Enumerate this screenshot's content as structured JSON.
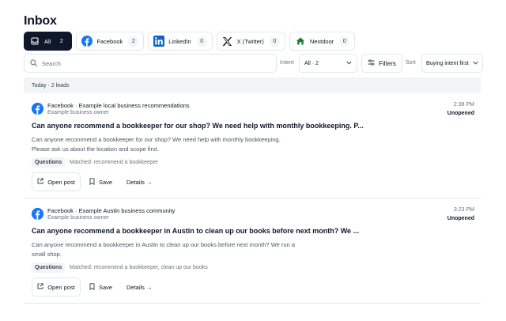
{
  "page": {
    "title": "Inbox"
  },
  "tabs": [
    {
      "label": "All",
      "count": "2",
      "icon": "inbox-icon",
      "active": true
    },
    {
      "label": "Facebook",
      "count": "2",
      "icon": "facebook-icon"
    },
    {
      "label": "LinkedIn",
      "count": "0",
      "icon": "linkedin-icon"
    },
    {
      "label": "X (Twitter)",
      "count": "0",
      "icon": "x-icon"
    },
    {
      "label": "Nextdoor",
      "count": "0",
      "icon": "nextdoor-icon"
    }
  ],
  "toolbar": {
    "search_placeholder": "Search",
    "intent_label": "Intent",
    "intent_value": "All · 2",
    "filters_label": "Filters",
    "sort_label": "Sort",
    "sort_value": "Buying intent first"
  },
  "group": {
    "label": "Today · 2 leads"
  },
  "leads": [
    {
      "source": "Facebook · Example local business recommendations",
      "author": "Example business owner",
      "time": "2:38 PM",
      "status": "Unopened",
      "title": "Can anyone recommend a bookkeeper for our shop? We need help with monthly bookkeeping. P...",
      "body_line1": "Can anyone recommend a bookkeeper for our shop? We need help with monthly bookkeeping.",
      "body_line2": "Please ask us about the location and scope first.",
      "tag": "Questions",
      "matched": "Matched: recommend a bookkeeper",
      "open_label": "Open post",
      "save_label": "Save",
      "details_label": "Details →"
    },
    {
      "source": "Facebook · Example Austin business community",
      "author": "Example business owner",
      "time": "3:23 PM",
      "status": "Unopened",
      "title": "Can anyone recommend a bookkeeper in Austin to clean up our books before next month? We ...",
      "body_line1": "Can anyone recommend a bookkeeper in Austin to clean up our books before next month? We run a",
      "body_line2": "small shop.",
      "tag": "Questions",
      "matched": "Matched: recommend a bookkeeper, clean up our books",
      "open_label": "Open post",
      "save_label": "Save",
      "details_label": "Details →"
    }
  ],
  "colors": {
    "primary_dark": "#0f172a",
    "facebook": "#1877f2",
    "linkedin": "#0a66c2",
    "nextdoor": "#1f7a3a"
  }
}
